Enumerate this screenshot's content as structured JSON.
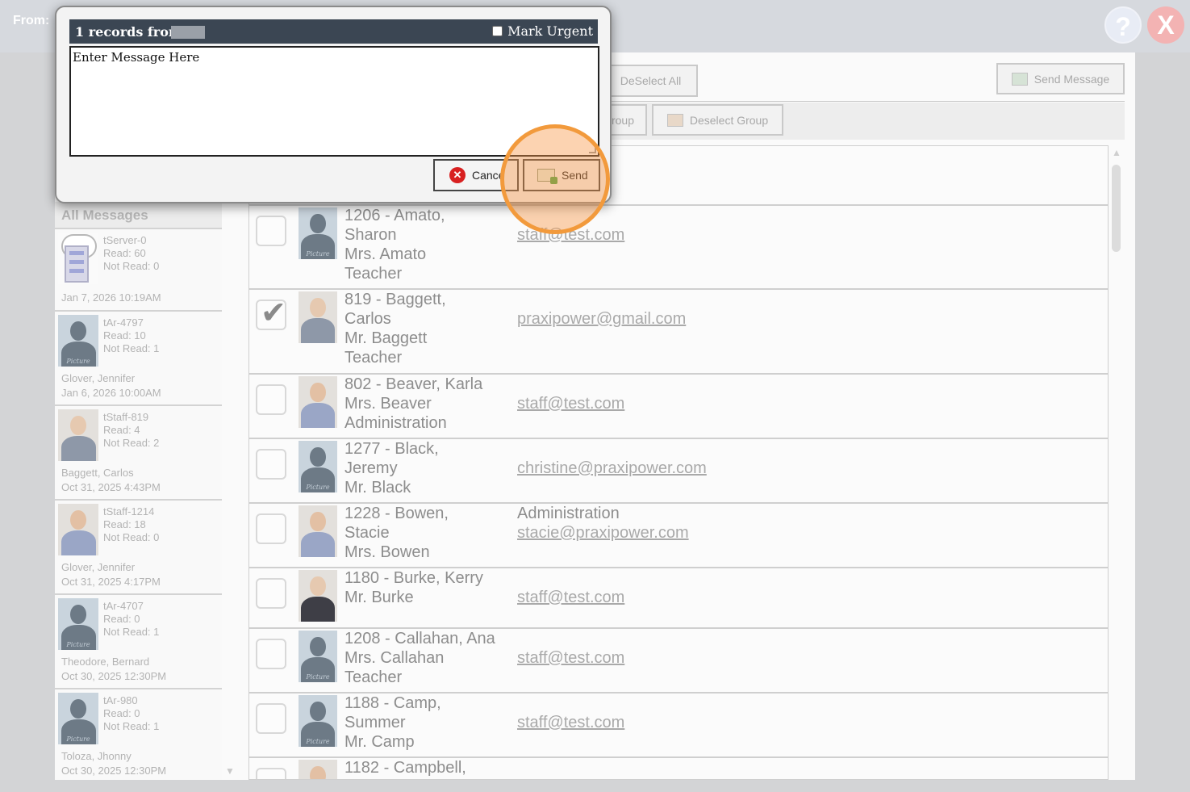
{
  "topbar": {
    "from_label": "From:",
    "help": "?",
    "close": "X"
  },
  "toolbar": {
    "deselect_all": "DeSelect All",
    "send_message": "Send Message",
    "select_group_partial": "roup",
    "deselect_group": "Deselect Group"
  },
  "dialog": {
    "title": "1 records from",
    "mark_urgent": "Mark Urgent",
    "message_placeholder": "Enter Message Here",
    "cancel": "Cance",
    "send": "Send"
  },
  "messages": {
    "header": "All Messages",
    "items": [
      {
        "id": "tServer-0",
        "read": "Read: 60",
        "not_read": "Not Read: 0",
        "name": "",
        "date": "Jan 7, 2026 10:19AM",
        "avatar": "server-icon"
      },
      {
        "id": "tAr-4797",
        "read": "Read: 10",
        "not_read": "Not Read: 1",
        "name": "Glover, Jennifer",
        "date": "Jan 6, 2026 10:00AM",
        "avatar": "picture-placeholder"
      },
      {
        "id": "tStaff-819",
        "read": "Read: 4",
        "not_read": "Not Read: 2",
        "name": "Baggett, Carlos",
        "date": "Oct 31, 2025 4:43PM",
        "avatar": "photo"
      },
      {
        "id": "tStaff-1214",
        "read": "Read: 18",
        "not_read": "Not Read: 0",
        "name": "Glover, Jennifer",
        "date": "Oct 31, 2025 4:17PM",
        "avatar": "photo-f"
      },
      {
        "id": "tAr-4707",
        "read": "Read: 0",
        "not_read": "Not Read: 1",
        "name": "Theodore, Bernard",
        "date": "Oct 30, 2025 12:30PM",
        "avatar": "picture-placeholder"
      },
      {
        "id": "tAr-980",
        "read": "Read: 0",
        "not_read": "Not Read: 1",
        "name": "Toloza, Jhonny",
        "date": "Oct 30, 2025 12:30PM",
        "avatar": "picture-placeholder"
      }
    ]
  },
  "recipients": [
    {
      "lines": [
        "1206 - Amato,",
        "Sharon",
        "Mrs. Amato",
        "Teacher"
      ],
      "extra": "",
      "email": "staff@test.com",
      "checked": false,
      "avatar": "picture-placeholder"
    },
    {
      "lines": [
        "819 - Baggett,",
        "Carlos",
        "Mr. Baggett",
        "Teacher"
      ],
      "extra": "",
      "email": "praxipower@gmail.com",
      "checked": true,
      "avatar": "photo"
    },
    {
      "lines": [
        "802 - Beaver, Karla",
        "Mrs. Beaver",
        "Administration"
      ],
      "extra": "",
      "email": "staff@test.com",
      "checked": false,
      "avatar": "photo-f"
    },
    {
      "lines": [
        "1277 - Black,",
        "Jeremy",
        "Mr. Black"
      ],
      "extra": "",
      "email": "christine@praxipower.com",
      "checked": false,
      "avatar": "picture-placeholder"
    },
    {
      "lines": [
        "1228 - Bowen,",
        "Stacie",
        "Mrs. Bowen"
      ],
      "extra": "Administration",
      "email": "stacie@praxipower.com",
      "checked": false,
      "avatar": "photo-f"
    },
    {
      "lines": [
        "1180 - Burke, Kerry",
        "Mr. Burke"
      ],
      "extra": "",
      "email": "staff@test.com",
      "checked": false,
      "avatar": "photo-dark"
    },
    {
      "lines": [
        "1208 - Callahan, Ana",
        "Mrs. Callahan",
        "Teacher"
      ],
      "extra": "",
      "email": "staff@test.com",
      "checked": false,
      "avatar": "picture-placeholder"
    },
    {
      "lines": [
        "1188 - Camp,",
        "Summer",
        "Mr. Camp"
      ],
      "extra": "",
      "email": "staff@test.com",
      "checked": false,
      "avatar": "picture-placeholder"
    },
    {
      "lines": [
        "1182 - Campbell,"
      ],
      "extra": "",
      "email": "",
      "checked": false,
      "avatar": "photo-f"
    }
  ],
  "avatar_caption": "Picture"
}
